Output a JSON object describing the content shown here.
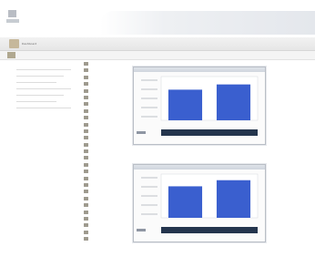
{
  "header": {
    "logo_text": ""
  },
  "toolbar": {
    "label": "Dashboard",
    "sub_label": ""
  },
  "breadcrumb": "",
  "left_nav": [
    "",
    "",
    "",
    "",
    "",
    "",
    ""
  ],
  "file_list": [
    "",
    "",
    "",
    "",
    "",
    "",
    "",
    "",
    "",
    "",
    "",
    "",
    "",
    "",
    "",
    "",
    "",
    "",
    "",
    "",
    "",
    "",
    "",
    "",
    "",
    "",
    ""
  ],
  "colors": {
    "bar": "#3a5fcf",
    "band": "#24354d",
    "panel_border": "#b9bec6"
  },
  "chart_data": [
    {
      "type": "bar",
      "title": "",
      "categories": [
        "",
        ""
      ],
      "values": [
        70,
        82
      ],
      "ylim": [
        0,
        100
      ],
      "xlabel": "",
      "ylabel": "",
      "grid": false,
      "legend": "none"
    },
    {
      "type": "bar",
      "title": "",
      "categories": [
        "",
        ""
      ],
      "values": [
        72,
        86
      ],
      "ylim": [
        0,
        100
      ],
      "xlabel": "",
      "ylabel": "",
      "grid": false,
      "legend": "none"
    }
  ]
}
